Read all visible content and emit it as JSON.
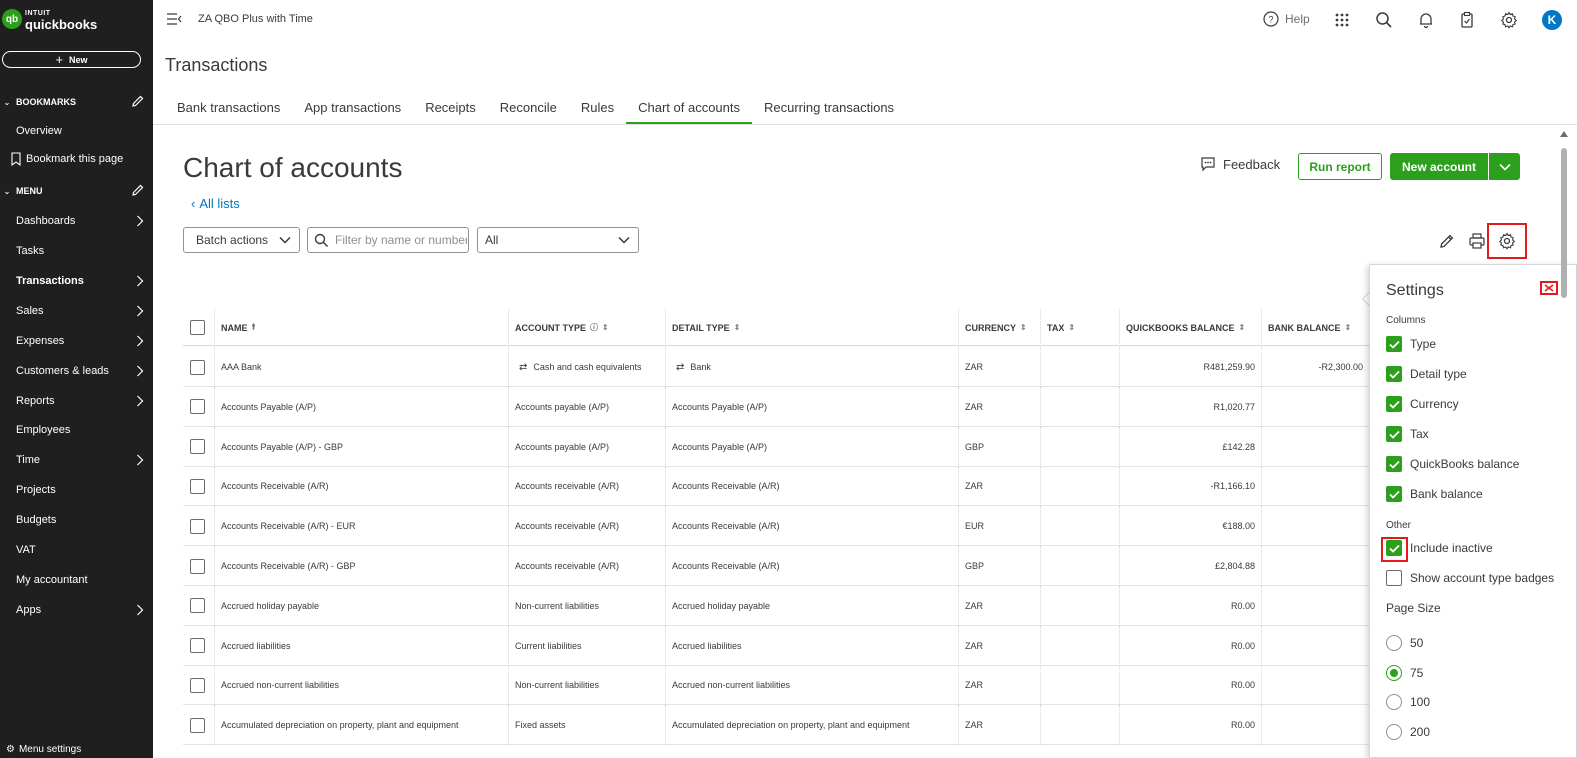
{
  "brand": {
    "intuit": "INTUIT",
    "name": "quickbooks",
    "mark": "qb"
  },
  "sidebar": {
    "new_label": "New",
    "bookmarks_label": "BOOKMARKS",
    "bookmark_items": [
      "Overview"
    ],
    "bookmark_this_page": "Bookmark this page",
    "menu_label": "MENU",
    "menu_items": [
      {
        "label": "Dashboards",
        "arrow": true
      },
      {
        "label": "Tasks",
        "arrow": false
      },
      {
        "label": "Transactions",
        "arrow": true,
        "active": true
      },
      {
        "label": "Sales",
        "arrow": true
      },
      {
        "label": "Expenses",
        "arrow": true
      },
      {
        "label": "Customers & leads",
        "arrow": true
      },
      {
        "label": "Reports",
        "arrow": true
      },
      {
        "label": "Employees",
        "arrow": false
      },
      {
        "label": "Time",
        "arrow": true
      },
      {
        "label": "Projects",
        "arrow": false
      },
      {
        "label": "Budgets",
        "arrow": false
      },
      {
        "label": "VAT",
        "arrow": false
      },
      {
        "label": "My accountant",
        "arrow": false
      },
      {
        "label": "Apps",
        "arrow": true
      }
    ],
    "menu_settings": "Menu settings"
  },
  "topbar": {
    "company": "ZA QBO Plus with Time",
    "help": "Help",
    "avatar": "K"
  },
  "page": {
    "heading": "Transactions",
    "tabs": [
      "Bank transactions",
      "App transactions",
      "Receipts",
      "Reconcile",
      "Rules",
      "Chart of accounts",
      "Recurring transactions"
    ],
    "active_tab": 5,
    "title": "Chart of accounts",
    "all_lists": "All lists",
    "feedback": "Feedback",
    "run_report": "Run report",
    "new_account": "New account",
    "batch_actions": "Batch actions",
    "search_placeholder": "Filter by name or number",
    "filter_value": "All"
  },
  "table": {
    "headers": [
      "NAME",
      "ACCOUNT TYPE",
      "DETAIL TYPE",
      "CURRENCY",
      "TAX",
      "QUICKBOOKS BALANCE",
      "BANK BALANCE"
    ],
    "rows": [
      {
        "name": "AAA Bank",
        "account_type": "Cash and cash equivalents",
        "detail_type": "Bank",
        "currency": "ZAR",
        "tax": "",
        "qb_balance": "R481,259.90",
        "bank_balance": "-R2,300.00",
        "badges": true
      },
      {
        "name": "Accounts Payable (A/P)",
        "account_type": "Accounts payable (A/P)",
        "detail_type": "Accounts Payable (A/P)",
        "currency": "ZAR",
        "tax": "",
        "qb_balance": "R1,020.77",
        "bank_balance": ""
      },
      {
        "name": "Accounts Payable (A/P) - GBP",
        "account_type": "Accounts payable (A/P)",
        "detail_type": "Accounts Payable (A/P)",
        "currency": "GBP",
        "tax": "",
        "qb_balance": "£142.28",
        "bank_balance": ""
      },
      {
        "name": "Accounts Receivable (A/R)",
        "account_type": "Accounts receivable (A/R)",
        "detail_type": "Accounts Receivable (A/R)",
        "currency": "ZAR",
        "tax": "",
        "qb_balance": "-R1,166.10",
        "bank_balance": ""
      },
      {
        "name": "Accounts Receivable (A/R) - EUR",
        "account_type": "Accounts receivable (A/R)",
        "detail_type": "Accounts Receivable (A/R)",
        "currency": "EUR",
        "tax": "",
        "qb_balance": "€188.00",
        "bank_balance": ""
      },
      {
        "name": "Accounts Receivable (A/R) - GBP",
        "account_type": "Accounts receivable (A/R)",
        "detail_type": "Accounts Receivable (A/R)",
        "currency": "GBP",
        "tax": "",
        "qb_balance": "£2,804.88",
        "bank_balance": ""
      },
      {
        "name": "Accrued holiday payable",
        "account_type": "Non-current liabilities",
        "detail_type": "Accrued holiday payable",
        "currency": "ZAR",
        "tax": "",
        "qb_balance": "R0.00",
        "bank_balance": ""
      },
      {
        "name": "Accrued liabilities",
        "account_type": "Current liabilities",
        "detail_type": "Accrued liabilities",
        "currency": "ZAR",
        "tax": "",
        "qb_balance": "R0.00",
        "bank_balance": ""
      },
      {
        "name": "Accrued non-current liabilities",
        "account_type": "Non-current liabilities",
        "detail_type": "Accrued non-current liabilities",
        "currency": "ZAR",
        "tax": "",
        "qb_balance": "R0.00",
        "bank_balance": ""
      },
      {
        "name": "Accumulated depreciation on property, plant and equipment",
        "account_type": "Fixed assets",
        "detail_type": "Accumulated depreciation on property, plant and equipment",
        "currency": "ZAR",
        "tax": "",
        "qb_balance": "R0.00",
        "bank_balance": ""
      }
    ]
  },
  "settings": {
    "title": "Settings",
    "columns_label": "Columns",
    "columns": [
      "Type",
      "Detail type",
      "Currency",
      "Tax",
      "QuickBooks balance",
      "Bank balance"
    ],
    "other_label": "Other",
    "include_inactive": "Include inactive",
    "show_badges": "Show account type badges",
    "page_size_label": "Page Size",
    "page_sizes": [
      "50",
      "75",
      "100",
      "200"
    ],
    "page_size_selected": "75"
  },
  "colors": {
    "brand_green": "#2ca01c",
    "highlight_red": "#e21a1a",
    "link_blue": "#0077c5",
    "sidebar_bg": "#1f1f1f"
  }
}
